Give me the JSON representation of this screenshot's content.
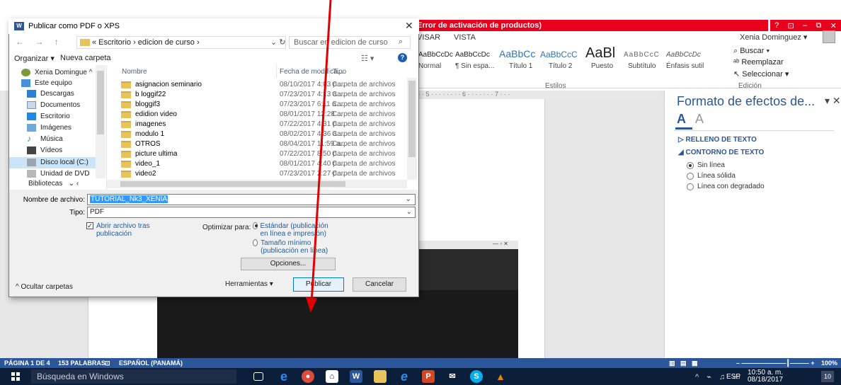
{
  "word": {
    "error_title": "Error de activación de productos)",
    "window_controls": [
      "?",
      "⊡",
      "–",
      "⧉",
      "✕"
    ],
    "tabs": [
      "VISAR",
      "VISTA"
    ],
    "user": "Xenia Dominguez ▾",
    "styles": [
      {
        "sample": "AaBbCcDc",
        "name": "Normal"
      },
      {
        "sample": "AaBbCcDc",
        "name": "¶ Sin espa..."
      },
      {
        "sample": "AaBbCc",
        "name": "Título 1"
      },
      {
        "sample": "AaBbCcC",
        "name": "Título 2"
      },
      {
        "sample": "AaBl",
        "name": "Puesto"
      },
      {
        "sample": "AaBbCcC",
        "name": "Subtítulo"
      },
      {
        "sample": "AaBbCcDc",
        "name": "Énfasis sutil"
      }
    ],
    "group_styles": "Estilos",
    "group_edit": "Edición",
    "edit_items": [
      "Buscar ▾",
      "Reemplazar",
      "Seleccionar ▾"
    ],
    "ruler_marks": "· · · 5 · · · · · · · · 6 · · · · · · · 7 · · ·",
    "pane": {
      "title": "Formato de efectos de...",
      "close": "▾ ✕",
      "section_fill": "RELLENO DE TEXTO",
      "section_outline": "CONTORNO DE TEXTO",
      "options": [
        "Sin línea",
        "Línea sólida",
        "Línea con degradado"
      ]
    },
    "status": {
      "page": "PÁGINA 1 DE 4",
      "words": "153 PALABRAS",
      "lang": "ESPAÑOL (PANAMÁ)",
      "zoom": "100%"
    }
  },
  "taskbar": {
    "search_placeholder": "Búsqueda en Windows",
    "lang": "ESP",
    "time": "10:50 a. m.",
    "date": "08/18/2017",
    "notifications": "10"
  },
  "dialog": {
    "title": "Publicar como PDF o XPS",
    "breadcrumb": "« Escritorio › edicion de curso ›",
    "search_placeholder": "Buscar en edicion de curso",
    "organize": "Organizar ▾",
    "new_folder": "Nueva carpeta",
    "nav_items": [
      "Xenia Domingue ^",
      "Este equipo",
      "Descargas",
      "Documentos",
      "Escritorio",
      "Imágenes",
      "Música",
      "Vídeos",
      "Disco local (C:)",
      "Unidad de DVD",
      "Bibliotecas"
    ],
    "columns": {
      "name": "Nombre",
      "date": "Fecha de modifica...",
      "type": "Tipo"
    },
    "files": [
      {
        "name": "asignacion seminario",
        "date": "08/10/2017 4:03 p....",
        "type": "Carpeta de archivos"
      },
      {
        "name": "b loggif22",
        "date": "07/23/2017 4:13 a....",
        "type": "Carpeta de archivos"
      },
      {
        "name": "bloggif3",
        "date": "07/23/2017 6:11 a....",
        "type": "Carpeta de archivos"
      },
      {
        "name": "edidion video",
        "date": "08/01/2017 12:28 ...",
        "type": "Carpeta de archivos"
      },
      {
        "name": "imagenes",
        "date": "07/22/2017 4:31 p....",
        "type": "Carpeta de archivos"
      },
      {
        "name": "modulo 1",
        "date": "08/02/2017 4:36 a....",
        "type": "Carpeta de archivos"
      },
      {
        "name": "OTROS",
        "date": "08/04/2017 11:59 a...",
        "type": "Carpeta de archivos"
      },
      {
        "name": "picture ultima",
        "date": "07/22/2017 8:50 p....",
        "type": "Carpeta de archivos"
      },
      {
        "name": "video_1",
        "date": "08/01/2017 4:40 p....",
        "type": "Carpeta de archivos"
      },
      {
        "name": "video2",
        "date": "07/23/2017 2:27 p....",
        "type": "Carpeta de archivos"
      }
    ],
    "filename_label": "Nombre de archivo:",
    "filename_value": "TUTORIAL_Nk3_XENIA",
    "type_label": "Tipo:",
    "type_value": "PDF",
    "open_after": "Abrir archivo tras publicación",
    "optimize_label": "Optimizar para:",
    "opt_standard": "Estándar (publicación en línea e impresión)",
    "opt_min": "Tamaño mínimo (publicación en línea)",
    "options_button": "Opciones...",
    "hide_folders": "^ Ocultar carpetas",
    "tools": "Herramientas ▾",
    "publish": "Publicar",
    "cancel": "Cancelar"
  },
  "colors": {
    "word_blue": "#2b579a",
    "error_red": "#e8001c",
    "annotation_arrow": "#e00000",
    "taskbar": "#0b1e3a"
  }
}
